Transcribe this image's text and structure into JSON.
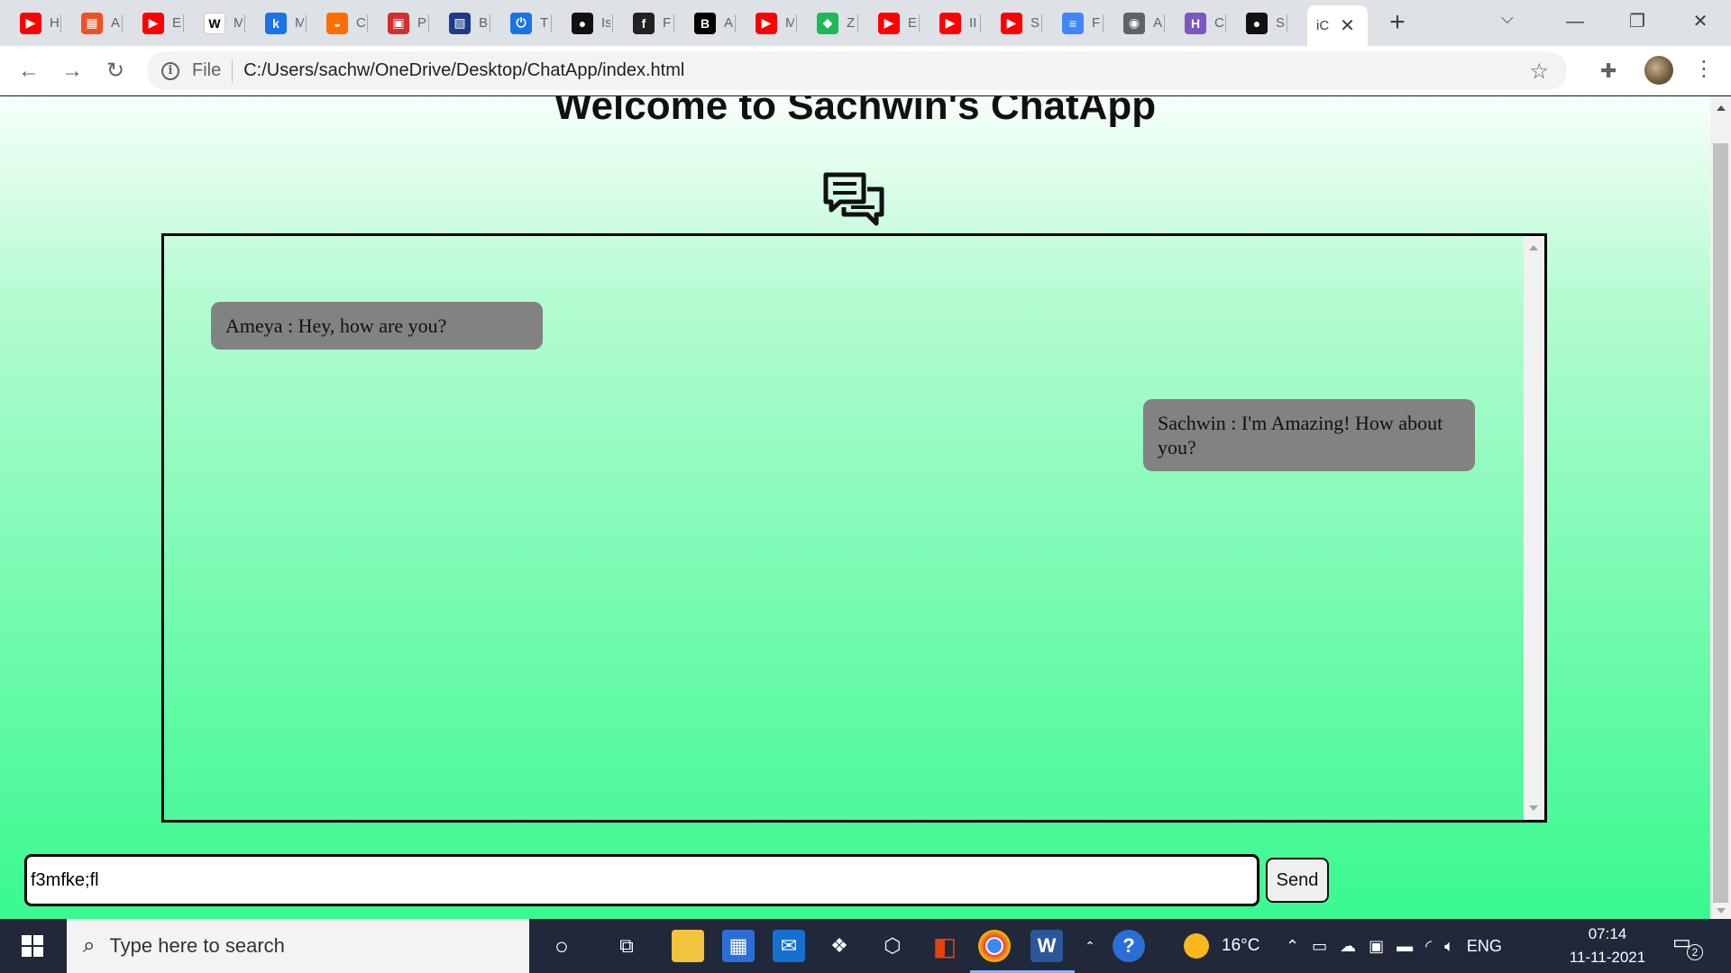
{
  "browser": {
    "tabs": [
      {
        "title": "H",
        "icon": "youtube-icon",
        "color": "#ff0000"
      },
      {
        "title": "A",
        "icon": "microsoft-icon",
        "color": "#f25022"
      },
      {
        "title": "E",
        "icon": "youtube-icon",
        "color": "#ff0000"
      },
      {
        "title": "M",
        "icon": "wikipedia-icon",
        "color": "#ffffff"
      },
      {
        "title": "M",
        "icon": "k-icon",
        "color": "#1a73e8"
      },
      {
        "title": "C",
        "icon": "cake-icon",
        "color": "#ff6d00"
      },
      {
        "title": "P",
        "icon": "package-icon",
        "color": "#d32f2f"
      },
      {
        "title": "B",
        "icon": "stripes-icon",
        "color": "#1e3a8a"
      },
      {
        "title": "T",
        "icon": "power-icon",
        "color": "#1a73e8"
      },
      {
        "title": "Is",
        "icon": "github-icon",
        "color": "#111111"
      },
      {
        "title": "F",
        "icon": "f-icon",
        "color": "#222222"
      },
      {
        "title": "A",
        "icon": "b-icon",
        "color": "#000000"
      },
      {
        "title": "M",
        "icon": "youtube-icon",
        "color": "#ff0000"
      },
      {
        "title": "Z",
        "icon": "shield-icon",
        "color": "#1db954"
      },
      {
        "title": "E",
        "icon": "youtube-icon",
        "color": "#ff0000"
      },
      {
        "title": "II",
        "icon": "youtube-icon",
        "color": "#ff0000"
      },
      {
        "title": "S",
        "icon": "youtube-icon",
        "color": "#ff0000"
      },
      {
        "title": "F",
        "icon": "docs-icon",
        "color": "#4285f4"
      },
      {
        "title": "A",
        "icon": "globe-icon",
        "color": "#5f6368"
      },
      {
        "title": "C",
        "icon": "h-icon",
        "color": "#7e57c2"
      },
      {
        "title": "S",
        "icon": "github-icon",
        "color": "#111111"
      }
    ],
    "active_tab": {
      "title": "iC",
      "close": "✕"
    },
    "new_tab": "+",
    "address": {
      "scheme": "File",
      "url": "C:/Users/sachw/OneDrive/Desktop/ChatApp/index.html"
    }
  },
  "page": {
    "title": "Welcome to Sachwin's ChatApp",
    "messages": [
      {
        "side": "left",
        "text": "Ameya : Hey, how are you?"
      },
      {
        "side": "right",
        "text": "Sachwin : I'm Amazing! How about you?"
      }
    ],
    "input": {
      "value": "f3mfke;fl"
    },
    "send_label": "Send"
  },
  "taskbar": {
    "search_placeholder": "Type here to search",
    "weather": "16°C",
    "language": "ENG",
    "time": "07:14",
    "date": "11-11-2021",
    "notification_count": "2"
  }
}
